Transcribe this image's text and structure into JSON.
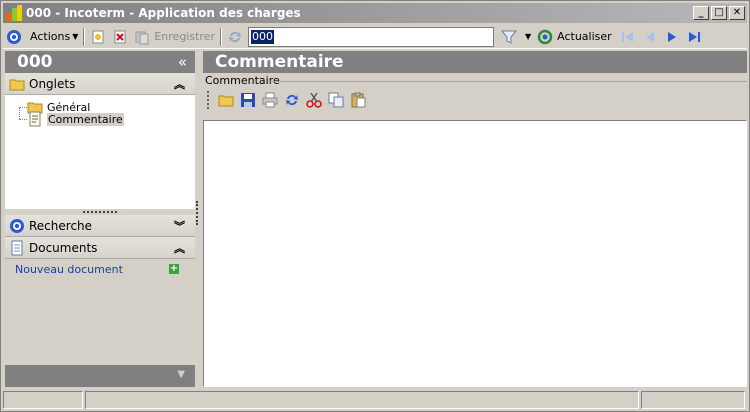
{
  "window": {
    "title": "000  -  Incoterm - Application des charges"
  },
  "titlebar_buttons": {
    "minimize": "_",
    "maximize": "□",
    "close": "✕"
  },
  "toolbar": {
    "actions_label": "Actions",
    "save_label": "Enregistrer",
    "search_value": "000",
    "refresh_label": "Actualiser"
  },
  "left_panel": {
    "header": "000",
    "collapse_glyph": "«",
    "tabs_group": {
      "label": "Onglets"
    },
    "tree": [
      {
        "label": "Général"
      },
      {
        "label": "Commentaire"
      }
    ],
    "search_group": {
      "label": "Recherche"
    },
    "documents_group": {
      "label": "Documents"
    },
    "new_document": "Nouveau document"
  },
  "right_panel": {
    "header": "Commentaire",
    "section_label": "Commentaire"
  },
  "colors": {
    "accent": "#0a246a",
    "link": "#1a3ca8",
    "header_bg": "#808080"
  }
}
